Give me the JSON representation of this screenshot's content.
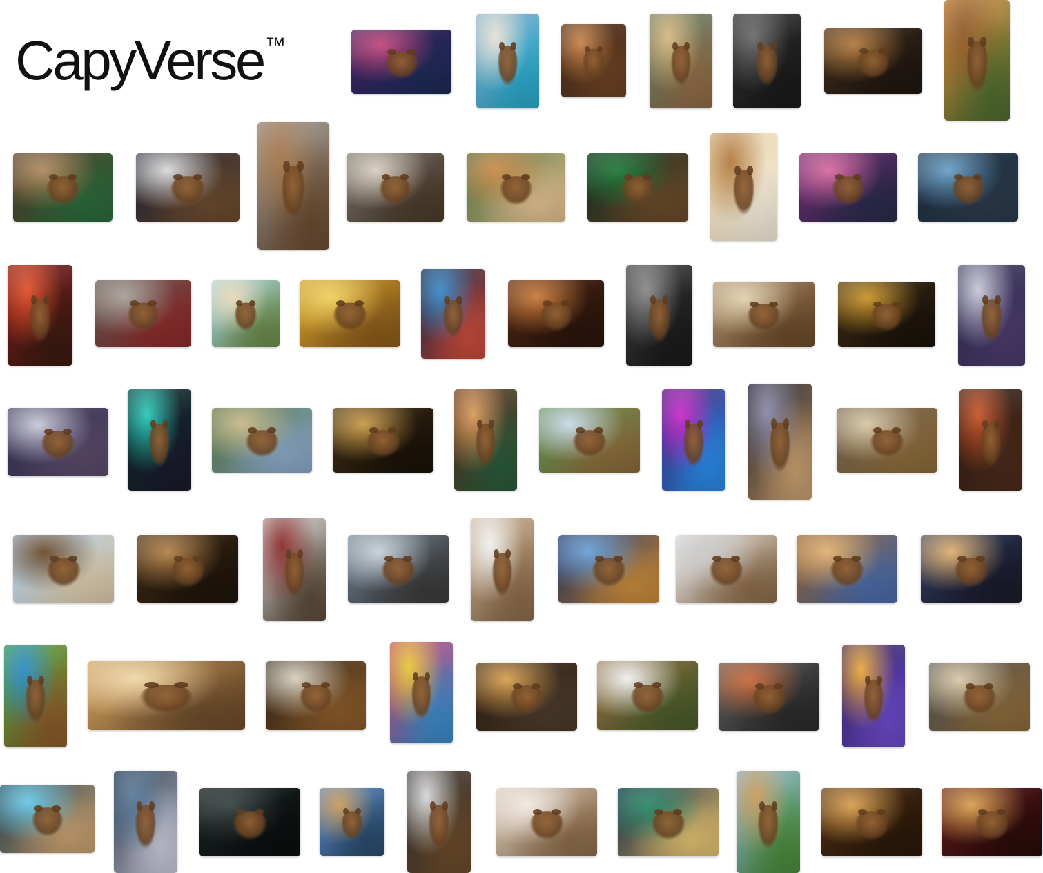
{
  "brand": {
    "name": "CapyVerse",
    "trademark": "™"
  },
  "gallery": {
    "tiles": [
      {
        "name": "neon-city-street-image",
        "colors": [
          "#3a1f5c",
          "#c2477a",
          "#1d2a55"
        ]
      },
      {
        "name": "mansion-pool-image",
        "colors": [
          "#7ba9c9",
          "#e7e2d6",
          "#2aa7c9"
        ]
      },
      {
        "name": "capybara-bathtub-image",
        "colors": [
          "#3b2413",
          "#c8844a",
          "#6b4124"
        ]
      },
      {
        "name": "tropical-resort-image",
        "colors": [
          "#5d7a63",
          "#d8b681",
          "#8e6a45"
        ]
      },
      {
        "name": "capybara-hoodie-image",
        "colors": [
          "#2e2e2e",
          "#6a6a6a",
          "#1a1a1a"
        ]
      },
      {
        "name": "capybara-tuxedo-dogs-image",
        "colors": [
          "#3a2a1a",
          "#b27a3e",
          "#1f1610"
        ]
      },
      {
        "name": "chateau-sunset-image",
        "colors": [
          "#d58a3c",
          "#8f5a2a",
          "#4f6b2e"
        ]
      },
      {
        "name": "stock-chart-office-image",
        "colors": [
          "#4a3424",
          "#b08a5e",
          "#2b6a3a"
        ]
      },
      {
        "name": "capybara-astronaut-image",
        "colors": [
          "#1c2030",
          "#d9d9d9",
          "#6b4a2e"
        ]
      },
      {
        "name": "capybara-closeup-image",
        "colors": [
          "#9a9a96",
          "#a5764a",
          "#6b4b30"
        ]
      },
      {
        "name": "banquet-table-image",
        "colors": [
          "#6e6a64",
          "#d8cfc0",
          "#4a3a2a"
        ]
      },
      {
        "name": "capybara-shiba-image",
        "colors": [
          "#4a6a3a",
          "#c98a4a",
          "#e0c090"
        ]
      },
      {
        "name": "trading-floor-image",
        "colors": [
          "#102a1c",
          "#1f7a3a",
          "#6a4a2a"
        ]
      },
      {
        "name": "capybara-halo-image",
        "colors": [
          "#e6d2a8",
          "#b27a3e",
          "#f3ead8"
        ]
      },
      {
        "name": "sports-car-sunset-image",
        "colors": [
          "#6a2a6e",
          "#d86aa0",
          "#2a2a4a"
        ]
      },
      {
        "name": "space-station-lounge-image",
        "colors": [
          "#1a2a3a",
          "#6aa0c8",
          "#2a3a4a"
        ]
      },
      {
        "name": "lantern-festival-image",
        "colors": [
          "#7a1a1a",
          "#e0502a",
          "#3a1a10"
        ]
      },
      {
        "name": "bull-riding-image",
        "colors": [
          "#5a5048",
          "#a8a09a",
          "#8a2a2a"
        ]
      },
      {
        "name": "beach-palm-image",
        "colors": [
          "#a8d8e8",
          "#e8d8b8",
          "#6a8a4a"
        ]
      },
      {
        "name": "gold-coins-image",
        "colors": [
          "#c89a2a",
          "#f0d060",
          "#8a5a1a"
        ]
      },
      {
        "name": "tokyo-tower-night-image",
        "colors": [
          "#102040",
          "#3a8ac8",
          "#c84a3a"
        ]
      },
      {
        "name": "fine-dining-room-image",
        "colors": [
          "#4a2414",
          "#c87a3a",
          "#2a140a"
        ]
      },
      {
        "name": "capybara-leather-jacket-image",
        "colors": [
          "#3a3a3a",
          "#8a8a8a",
          "#1a1a1a"
        ]
      },
      {
        "name": "taj-mahal-feast-image",
        "colors": [
          "#a88a6a",
          "#e0d0b0",
          "#6a4a2a"
        ]
      },
      {
        "name": "goldsmith-workshop-image",
        "colors": [
          "#3a2a14",
          "#c8942a",
          "#1a120a"
        ]
      },
      {
        "name": "space-suit-capybara-image",
        "colors": [
          "#2a2a4a",
          "#c8c8d8",
          "#4a3a6a"
        ]
      },
      {
        "name": "moon-party-image",
        "colors": [
          "#2a2a4a",
          "#c8c8d8",
          "#5a4a6a"
        ]
      },
      {
        "name": "cyberpunk-capybara-image",
        "colors": [
          "#0a2a2a",
          "#2ac8b8",
          "#1a1a2a"
        ]
      },
      {
        "name": "mansion-lawn-money-image",
        "colors": [
          "#4a6a3a",
          "#c8b88a",
          "#8aa8c8"
        ]
      },
      {
        "name": "gala-tuxedo-image",
        "colors": [
          "#3a2a14",
          "#c89a4a",
          "#1a1208"
        ]
      },
      {
        "name": "casino-roulette-image",
        "colors": [
          "#5a2a1a",
          "#d89a5a",
          "#2a5a3a"
        ]
      },
      {
        "name": "lakeside-picnic-image",
        "colors": [
          "#5a8a4a",
          "#c8d8e8",
          "#8a6a3a"
        ]
      },
      {
        "name": "neon-dance-party-image",
        "colors": [
          "#3a1a6a",
          "#c82ac8",
          "#2a8ae8"
        ]
      },
      {
        "name": "rocket-launch-image",
        "colors": [
          "#0a0a14",
          "#8a8aa8",
          "#c8a070"
        ]
      },
      {
        "name": "mona-lisa-gallery-image",
        "colors": [
          "#6a5a4a",
          "#d8c8a8",
          "#8a6a3a"
        ]
      },
      {
        "name": "coastal-sunset-drive-image",
        "colors": [
          "#2a1a10",
          "#c8542a",
          "#4a2a1a"
        ]
      },
      {
        "name": "polo-horse-image",
        "colors": [
          "#a8c8e8",
          "#6a4a2a",
          "#d8c8a8"
        ]
      },
      {
        "name": "capybara-cowboy-hat-image",
        "colors": [
          "#3a2614",
          "#b2824a",
          "#1e140a"
        ]
      },
      {
        "name": "capybara-flannel-image",
        "colors": [
          "#d8d8d8",
          "#8a2a2a",
          "#5a4a3a"
        ]
      },
      {
        "name": "skyline-lounge-image",
        "colors": [
          "#6a7a8a",
          "#c8d0d8",
          "#3a3a3a"
        ]
      },
      {
        "name": "capybara-white-tee-image",
        "colors": [
          "#c8b090",
          "#f0f0f0",
          "#8a6a4a"
        ]
      },
      {
        "name": "jet-party-image",
        "colors": [
          "#1a2a5a",
          "#6aa0d8",
          "#c88a3a"
        ]
      },
      {
        "name": "photo-studio-image",
        "colors": [
          "#e8e8e8",
          "#c8c8c8",
          "#8a6a4a"
        ]
      },
      {
        "name": "beer-hall-image",
        "colors": [
          "#8a5a2a",
          "#e0b070",
          "#4a6aa8"
        ]
      },
      {
        "name": "mansion-party-night-image",
        "colors": [
          "#2a3a5a",
          "#e0b070",
          "#1a1a2a"
        ]
      },
      {
        "name": "water-gun-lawn-image",
        "colors": [
          "#4aa83a",
          "#2a8ac8",
          "#8a5a2a"
        ]
      },
      {
        "name": "spa-stones-image",
        "colors": [
          "#c89a5a",
          "#f0d8a8",
          "#6a4a2a"
        ]
      },
      {
        "name": "india-astronaut-image",
        "colors": [
          "#2a2014",
          "#d8d0c0",
          "#8a5a2a"
        ]
      },
      {
        "name": "mexican-fiesta-image",
        "colors": [
          "#c83a6a",
          "#e8c83a",
          "#3a8ac8"
        ]
      },
      {
        "name": "grand-hotel-night-image",
        "colors": [
          "#2a1a10",
          "#d8a050",
          "#4a3a2a"
        ]
      },
      {
        "name": "spa-towel-image",
        "colors": [
          "#8a6a3a",
          "#f0f0f0",
          "#4a5a2a"
        ]
      },
      {
        "name": "highway-convertible-image",
        "colors": [
          "#5a5a5a",
          "#c86a3a",
          "#2a2a2a"
        ]
      },
      {
        "name": "cosmic-disco-image",
        "colors": [
          "#2a1a5a",
          "#e8a83a",
          "#6a4ac8"
        ]
      },
      {
        "name": "rooftop-dinner-image",
        "colors": [
          "#4a4a4a",
          "#d8c8a8",
          "#8a6a3a"
        ]
      },
      {
        "name": "ai-cyborg-capybara-image",
        "colors": [
          "#1a3a4a",
          "#6ac8e8",
          "#c8a070"
        ]
      },
      {
        "name": "space-bar-window-image",
        "colors": [
          "#1a2a3a",
          "#5a7a9a",
          "#c8c8d8"
        ]
      },
      {
        "name": "black-capybara-image",
        "colors": [
          "#1a2020",
          "#3a4444",
          "#0a0e0e"
        ]
      },
      {
        "name": "capy-hills-magazine-image",
        "colors": [
          "#5a8ac8",
          "#c89a5a",
          "#2a4a6a"
        ]
      },
      {
        "name": "diamond-closeup-image",
        "colors": [
          "#2a2a2a",
          "#d8d8d8",
          "#6a4a2a"
        ]
      },
      {
        "name": "pedicure-salon-image",
        "colors": [
          "#d8c8b8",
          "#f0e8e0",
          "#8a6a4a"
        ]
      },
      {
        "name": "palace-pool-night-image",
        "colors": [
          "#102040",
          "#2a8a6a",
          "#e0c070"
        ]
      },
      {
        "name": "unicorn-capybara-image",
        "colors": [
          "#8ab8d8",
          "#c89a5a",
          "#4a8a3a"
        ]
      },
      {
        "name": "ballroom-crowd-image",
        "colors": [
          "#4a2a14",
          "#d8a050",
          "#2a1808"
        ]
      },
      {
        "name": "opera-theater-image",
        "colors": [
          "#5a1a1a",
          "#d8a050",
          "#2a0a0a"
        ]
      }
    ]
  }
}
